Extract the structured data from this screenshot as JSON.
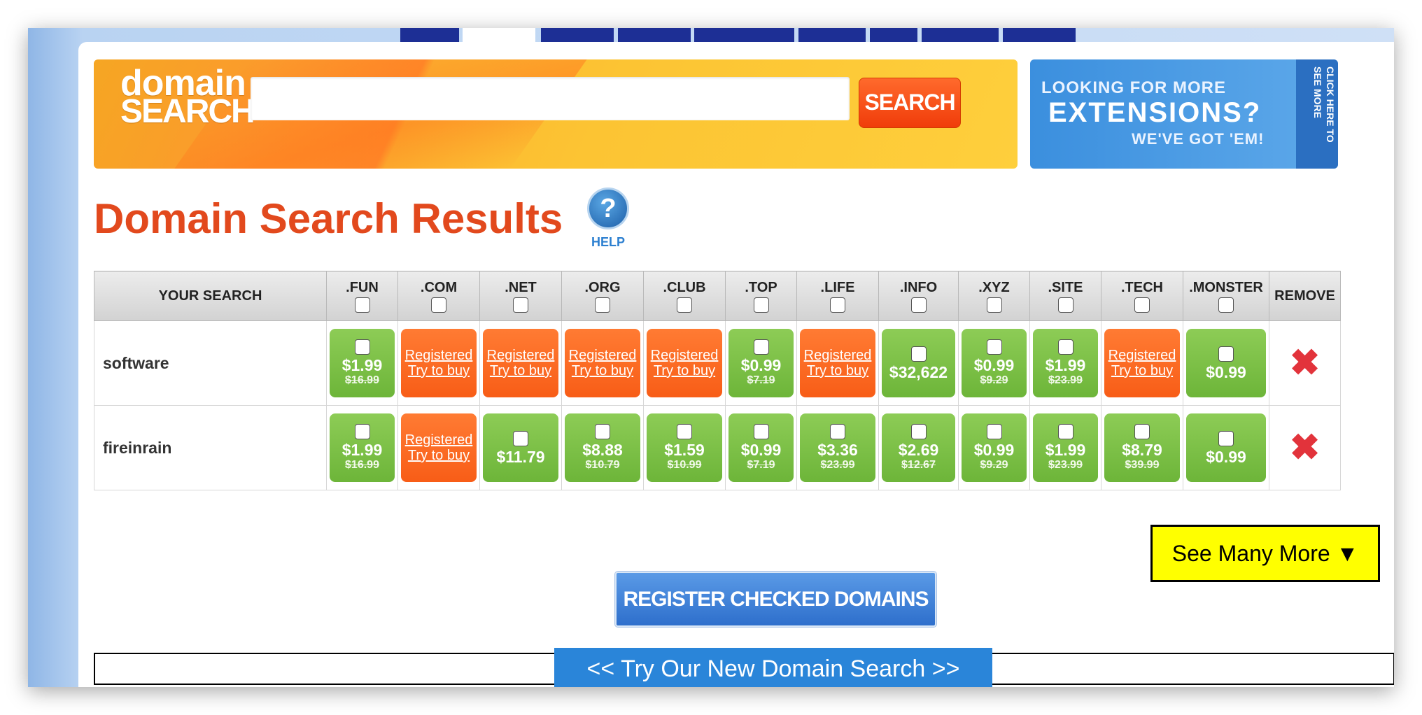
{
  "banner": {
    "logo_line1": "domain",
    "logo_line2": "SEARCH",
    "search_value": "",
    "search_button": "SEARCH"
  },
  "extensions_banner": {
    "line1": "LOOKING FOR MORE",
    "line2": "EXTENSIONS?",
    "line3": "WE'VE GOT 'EM!",
    "side": "CLICK HERE TO SEE MORE"
  },
  "page_title": "Domain Search Results",
  "help": {
    "icon": "?",
    "label": "HELP"
  },
  "table": {
    "search_header": "YOUR SEARCH",
    "remove_header": "REMOVE",
    "tlds": [
      ".FUN",
      ".COM",
      ".NET",
      ".ORG",
      ".CLUB",
      ".TOP",
      ".LIFE",
      ".INFO",
      ".XYZ",
      ".SITE",
      ".TECH",
      ".MONSTER"
    ],
    "registered_label_1": "Registered",
    "registered_label_2": "Try to buy",
    "rows": [
      {
        "term": "software",
        "cells": [
          {
            "status": "available",
            "price": "$1.99",
            "old": "$16.99"
          },
          {
            "status": "registered"
          },
          {
            "status": "registered"
          },
          {
            "status": "registered"
          },
          {
            "status": "registered"
          },
          {
            "status": "available",
            "price": "$0.99",
            "old": "$7.19"
          },
          {
            "status": "registered"
          },
          {
            "status": "available",
            "price": "$32,622",
            "old": ""
          },
          {
            "status": "available",
            "price": "$0.99",
            "old": "$9.29"
          },
          {
            "status": "available",
            "price": "$1.99",
            "old": "$23.99"
          },
          {
            "status": "registered"
          },
          {
            "status": "available",
            "price": "$0.99",
            "old": ""
          }
        ]
      },
      {
        "term": "fireinrain",
        "cells": [
          {
            "status": "available",
            "price": "$1.99",
            "old": "$16.99"
          },
          {
            "status": "registered"
          },
          {
            "status": "available",
            "price": "$11.79",
            "old": ""
          },
          {
            "status": "available",
            "price": "$8.88",
            "old": "$10.79"
          },
          {
            "status": "available",
            "price": "$1.59",
            "old": "$10.99"
          },
          {
            "status": "available",
            "price": "$0.99",
            "old": "$7.19"
          },
          {
            "status": "available",
            "price": "$3.36",
            "old": "$23.99"
          },
          {
            "status": "available",
            "price": "$2.69",
            "old": "$12.67"
          },
          {
            "status": "available",
            "price": "$0.99",
            "old": "$9.29"
          },
          {
            "status": "available",
            "price": "$1.99",
            "old": "$23.99"
          },
          {
            "status": "available",
            "price": "$8.79",
            "old": "$39.99"
          },
          {
            "status": "available",
            "price": "$0.99",
            "old": ""
          }
        ]
      }
    ]
  },
  "see_many_more": "See Many More ▼",
  "register_button": "REGISTER CHECKED DOMAINS",
  "new_search_button": "<< Try Our New Domain Search >>",
  "colors": {
    "available": "#74ba3f",
    "registered": "#fb6420",
    "title": "#e2491d",
    "see_more_bg": "#ffff00",
    "remove": "#e2333b"
  }
}
